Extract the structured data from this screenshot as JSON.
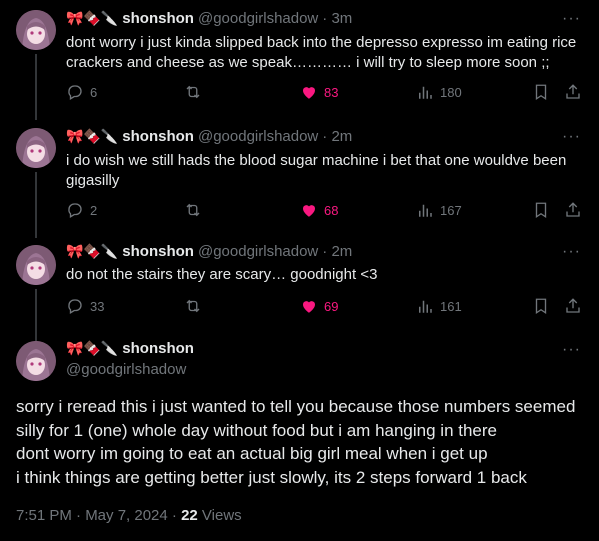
{
  "author": {
    "emojis": "🎀🍫🔪",
    "name": "shonshon",
    "handle": "@goodgirlshadow"
  },
  "more_glyph": "···",
  "replies": [
    {
      "time": "· 3m",
      "text": "dont worry i just kinda slipped back into the depresso expresso im eating rice crackers and cheese as we speak………… i will try to sleep more soon ;;",
      "reply_count": "6",
      "like_count": "83",
      "view_count": "180"
    },
    {
      "time": "· 2m",
      "text": "i do wish we still hads the blood sugar machine i bet that one wouldve been gigasilly",
      "reply_count": "2",
      "like_count": "68",
      "view_count": "167"
    },
    {
      "time": "· 2m",
      "text": "do not the stairs they are scary… goodnight <3",
      "reply_count": "33",
      "like_count": "69",
      "view_count": "161"
    }
  ],
  "main_tweet": {
    "lines": [
      "sorry i reread this i just wanted to tell you because those numbers seemed silly for 1 (one) whole day without food but i am hanging in there",
      "dont worry im going to eat an actual big girl meal when i get up",
      "i think things are getting better just slowly, its 2 steps forward 1 back"
    ],
    "timestamp": "7:51 PM · May 7, 2024 · ",
    "views_count": "22",
    "views_label": " Views"
  },
  "colors": {
    "background": "#000000",
    "text": "#e7e9ea",
    "muted": "#71767b",
    "like": "#f91880"
  },
  "icons": [
    "reply-icon",
    "retweet-icon",
    "heart-icon",
    "views-icon",
    "bookmark-icon",
    "share-icon",
    "more-icon"
  ]
}
